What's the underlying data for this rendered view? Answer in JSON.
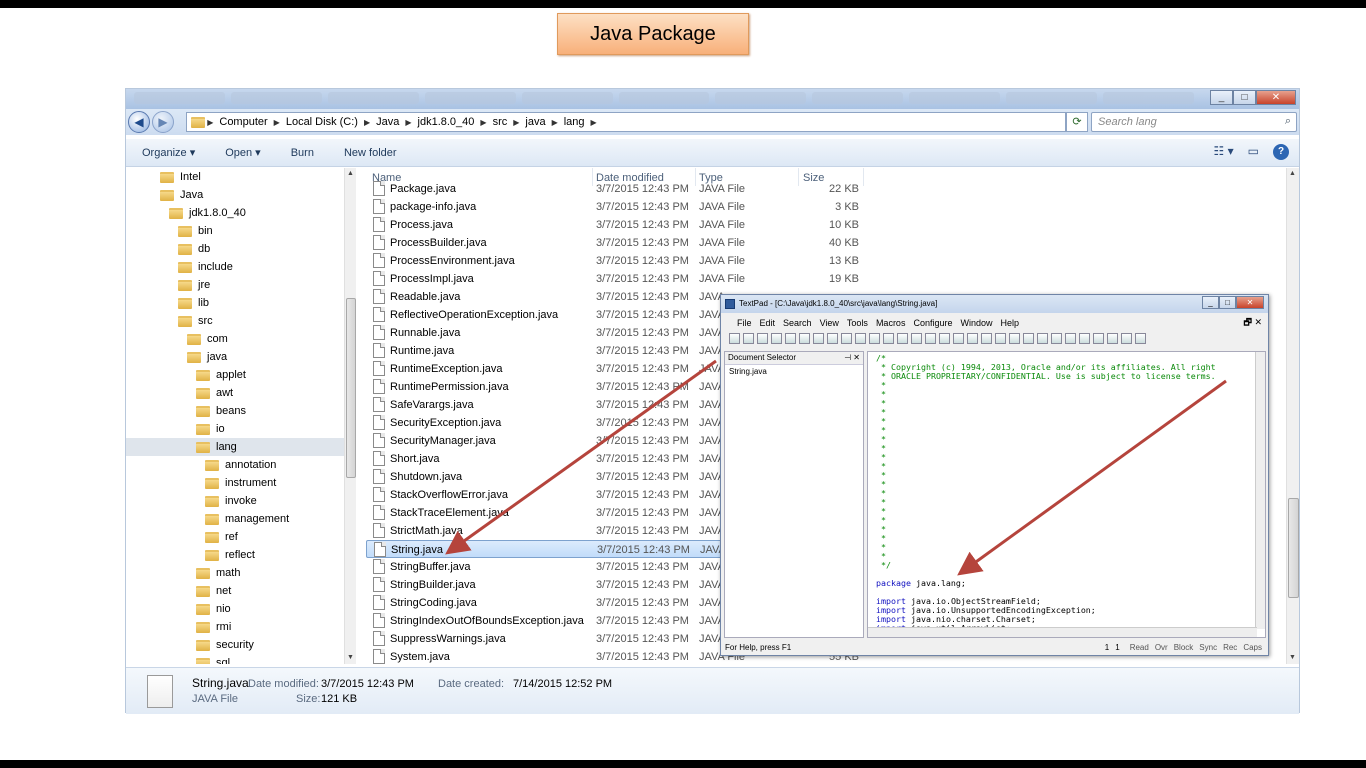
{
  "slide": {
    "title": "Java Package"
  },
  "explorer": {
    "address": [
      "Computer",
      "Local Disk (C:)",
      "Java",
      "jdk1.8.0_40",
      "src",
      "java",
      "lang"
    ],
    "search_placeholder": "Search lang",
    "commands": {
      "organize": "Organize ▾",
      "open": "Open ▾",
      "burn": "Burn",
      "new_folder": "New folder"
    },
    "tree": [
      {
        "label": "Intel",
        "depth": 0
      },
      {
        "label": "Java",
        "depth": 0
      },
      {
        "label": "jdk1.8.0_40",
        "depth": 1
      },
      {
        "label": "bin",
        "depth": 2
      },
      {
        "label": "db",
        "depth": 2
      },
      {
        "label": "include",
        "depth": 2
      },
      {
        "label": "jre",
        "depth": 2
      },
      {
        "label": "lib",
        "depth": 2
      },
      {
        "label": "src",
        "depth": 2
      },
      {
        "label": "com",
        "depth": 3
      },
      {
        "label": "java",
        "depth": 3
      },
      {
        "label": "applet",
        "depth": 4
      },
      {
        "label": "awt",
        "depth": 4
      },
      {
        "label": "beans",
        "depth": 4
      },
      {
        "label": "io",
        "depth": 4
      },
      {
        "label": "lang",
        "depth": 4,
        "selected": true
      },
      {
        "label": "annotation",
        "depth": 5
      },
      {
        "label": "instrument",
        "depth": 5
      },
      {
        "label": "invoke",
        "depth": 5
      },
      {
        "label": "management",
        "depth": 5
      },
      {
        "label": "ref",
        "depth": 5
      },
      {
        "label": "reflect",
        "depth": 5
      },
      {
        "label": "math",
        "depth": 4
      },
      {
        "label": "net",
        "depth": 4
      },
      {
        "label": "nio",
        "depth": 4
      },
      {
        "label": "rmi",
        "depth": 4
      },
      {
        "label": "security",
        "depth": 4
      },
      {
        "label": "sql",
        "depth": 4
      }
    ],
    "columns": {
      "name": "Name",
      "date": "Date modified",
      "type": "Type",
      "size": "Size"
    },
    "files": [
      {
        "name": "Package.java",
        "date": "3/7/2015 12:43 PM",
        "type": "JAVA File",
        "size": "22 KB"
      },
      {
        "name": "package-info.java",
        "date": "3/7/2015 12:43 PM",
        "type": "JAVA File",
        "size": "3 KB"
      },
      {
        "name": "Process.java",
        "date": "3/7/2015 12:43 PM",
        "type": "JAVA File",
        "size": "10 KB"
      },
      {
        "name": "ProcessBuilder.java",
        "date": "3/7/2015 12:43 PM",
        "type": "JAVA File",
        "size": "40 KB"
      },
      {
        "name": "ProcessEnvironment.java",
        "date": "3/7/2015 12:43 PM",
        "type": "JAVA File",
        "size": "13 KB"
      },
      {
        "name": "ProcessImpl.java",
        "date": "3/7/2015 12:43 PM",
        "type": "JAVA File",
        "size": "19 KB"
      },
      {
        "name": "Readable.java",
        "date": "3/7/2015 12:43 PM",
        "type": "JAVA",
        "size": ""
      },
      {
        "name": "ReflectiveOperationException.java",
        "date": "3/7/2015 12:43 PM",
        "type": "JAVA",
        "size": ""
      },
      {
        "name": "Runnable.java",
        "date": "3/7/2015 12:43 PM",
        "type": "JAVA",
        "size": ""
      },
      {
        "name": "Runtime.java",
        "date": "3/7/2015 12:43 PM",
        "type": "JAVA",
        "size": ""
      },
      {
        "name": "RuntimeException.java",
        "date": "3/7/2015 12:43 PM",
        "type": "JAVA",
        "size": ""
      },
      {
        "name": "RuntimePermission.java",
        "date": "3/7/2015 12:43 PM",
        "type": "JAVA",
        "size": ""
      },
      {
        "name": "SafeVarargs.java",
        "date": "3/7/2015 12:43 PM",
        "type": "JAVA",
        "size": ""
      },
      {
        "name": "SecurityException.java",
        "date": "3/7/2015 12:43 PM",
        "type": "JAVA",
        "size": ""
      },
      {
        "name": "SecurityManager.java",
        "date": "3/7/2015 12:43 PM",
        "type": "JAVA",
        "size": ""
      },
      {
        "name": "Short.java",
        "date": "3/7/2015 12:43 PM",
        "type": "JAVA",
        "size": ""
      },
      {
        "name": "Shutdown.java",
        "date": "3/7/2015 12:43 PM",
        "type": "JAVA",
        "size": ""
      },
      {
        "name": "StackOverflowError.java",
        "date": "3/7/2015 12:43 PM",
        "type": "JAVA",
        "size": ""
      },
      {
        "name": "StackTraceElement.java",
        "date": "3/7/2015 12:43 PM",
        "type": "JAVA",
        "size": ""
      },
      {
        "name": "StrictMath.java",
        "date": "3/7/2015 12:43 PM",
        "type": "JAVA",
        "size": ""
      },
      {
        "name": "String.java",
        "date": "3/7/2015 12:43 PM",
        "type": "JAVA",
        "size": "",
        "selected": true
      },
      {
        "name": "StringBuffer.java",
        "date": "3/7/2015 12:43 PM",
        "type": "JAVA",
        "size": ""
      },
      {
        "name": "StringBuilder.java",
        "date": "3/7/2015 12:43 PM",
        "type": "JAVA",
        "size": ""
      },
      {
        "name": "StringCoding.java",
        "date": "3/7/2015 12:43 PM",
        "type": "JAVA",
        "size": ""
      },
      {
        "name": "StringIndexOutOfBoundsException.java",
        "date": "3/7/2015 12:43 PM",
        "type": "JAVA",
        "size": ""
      },
      {
        "name": "SuppressWarnings.java",
        "date": "3/7/2015 12:43 PM",
        "type": "JAVA",
        "size": ""
      },
      {
        "name": "System.java",
        "date": "3/7/2015 12:43 PM",
        "type": "JAVA File",
        "size": "55 KB"
      }
    ],
    "details": {
      "filename": "String.java",
      "modified_label": "Date modified:",
      "modified": "3/7/2015 12:43 PM",
      "created_label": "Date created:",
      "created": "7/14/2015 12:52 PM",
      "type": "JAVA File",
      "size_label": "Size:",
      "size": "121 KB"
    }
  },
  "textpad": {
    "title": "TextPad - [C:\\Java\\jdk1.8.0_40\\src\\java\\lang\\String.java]",
    "menu": [
      "File",
      "Edit",
      "Search",
      "View",
      "Tools",
      "Macros",
      "Configure",
      "Window",
      "Help"
    ],
    "doc_selector": "Document Selector",
    "doc_item": "String.java",
    "code_comment": [
      "/*",
      " * Copyright (c) 1994, 2013, Oracle and/or its affiliates. All right",
      " * ORACLE PROPRIETARY/CONFIDENTIAL. Use is subject to license terms.",
      " *",
      " *",
      " *",
      " *",
      " *",
      " *",
      " *",
      " *",
      " *",
      " *",
      " *",
      " *",
      " *",
      " *",
      " *",
      " *",
      " *",
      " *",
      " *",
      " *",
      " */"
    ],
    "code_package": "package java.lang;",
    "code_imports": [
      "import java.io.ObjectStreamField;",
      "import java.io.UnsupportedEncodingException;",
      "import java.nio.charset.Charset;",
      "import java.util.ArrayList;"
    ],
    "status_help": "For Help, press F1",
    "status_line": "1",
    "status_col": "1",
    "status_flags": [
      "Read",
      "Ovr",
      "Block",
      "Sync",
      "Rec",
      "Caps"
    ]
  },
  "colors": {
    "arrow": "#b5443c",
    "title_bg": "#f8b07a",
    "selection": "#cce4fb"
  }
}
